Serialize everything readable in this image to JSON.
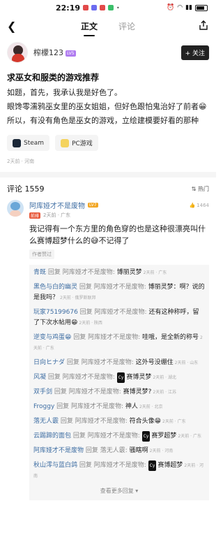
{
  "status_bar": {
    "time": "22:19",
    "battery": "100"
  },
  "nav": {
    "back_icon": "chevron-left-icon",
    "tabs": [
      {
        "label": "正文"
      },
      {
        "label": "评论"
      }
    ],
    "share_icon": "share-icon"
  },
  "author": {
    "name": "榨檬123",
    "level": "LV5",
    "follow_label": "+ 关注"
  },
  "post": {
    "title": "求巫女和服类的游戏推荐",
    "lines": [
      "如题，首先，我承认我是好色了。",
      "眼馋零濡鸦巫女里的巫女姐姐，但好色跟怕鬼治好了前者😁",
      "所以，有没有角色是巫女的游戏，立绘建模要好看的那种"
    ],
    "tags": [
      {
        "label": "Steam"
      },
      {
        "label": "PC游戏"
      }
    ],
    "meta": "2天前 · 河南"
  },
  "comments_header": {
    "title": "评论 1559",
    "sort": "热门"
  },
  "comment": {
    "name": "阿库娅才不是废物",
    "badge": "LV7",
    "sub_badge": "前排",
    "sub_meta": "2天前 · 广东",
    "likes": "1464",
    "text": "我记得有一个东方里的角色穿的也是这种很漂亮叫什么赛博超梦什么的😅不记得了",
    "author_liked": "作者赞过"
  },
  "replies": [
    {
      "name": "青既",
      "mid": " 回复 阿库娅才不是废物: ",
      "text": "博丽灵梦",
      "meta": "2天前 · 广东"
    },
    {
      "name": "黑色与白的幽灵",
      "mid": " 回复 阿库娅才不是废物: ",
      "text": "博丽灵梦：啊？说的是我吗？",
      "meta": "2天前 · 俄罗斯联邦"
    },
    {
      "name": "玩家75199676",
      "mid": " 回复 阿库娅才不是废物: ",
      "text": "还有这种称呼，留了下次水帖用😁",
      "meta": "2天前 · 陕西"
    },
    {
      "name": "逆变与鸡蛋😁",
      "mid": " 回复 阿库娅才不是废物: ",
      "text": "哇哦，是全新的称号",
      "meta": "2天前 · 广东"
    },
    {
      "name": "日向ヒナダ",
      "mid": " 回复 阿库娅才不是废物: ",
      "text": "这外号没绷住",
      "meta": "2天前 · 山东"
    },
    {
      "name": "风凝",
      "mid": " 回复 阿库娅才不是废物: ",
      "cy": "Cy",
      "text": "赛博灵梦",
      "meta": "2天前 · 湖北"
    },
    {
      "name": "双手剑",
      "mid": " 回复 阿库娅才不是废物: ",
      "text": "赛博灵梦?",
      "meta": "2天前 · 江苏"
    },
    {
      "name": "Froggy",
      "mid": " 回复 阿库娅才不是废物: ",
      "text": "神人",
      "meta": "2天前 · 北京"
    },
    {
      "name": "落无人霰",
      "mid": " 回复 阿库娅才不是废物: ",
      "text": "符合头像😁",
      "meta": "2天前 · 广东"
    },
    {
      "name": "云踢蹄的面包",
      "mid": " 回复 阿库娅才不是废物: ",
      "cy": "Cy",
      "text": "赛罗超梦",
      "meta": "2天前 · 广东"
    },
    {
      "name": "阿库娅才不是废物",
      "mid": " 回复 落无人霰: ",
      "text": "骚瞎啊",
      "meta": "2天前 · 河南"
    },
    {
      "name": "秋山澪与蓝白鸽",
      "mid": " 回复 阿库娅才不是废物: ",
      "cy": "Cy",
      "text": "赛博超梦",
      "meta": "2天前 · 河南"
    }
  ],
  "more_replies": "查看更多回复 ▾",
  "colors": {
    "link_blue": "#3f6ea3",
    "lv_purple": "#b07cf0",
    "badge_orange": "#f2a623"
  }
}
